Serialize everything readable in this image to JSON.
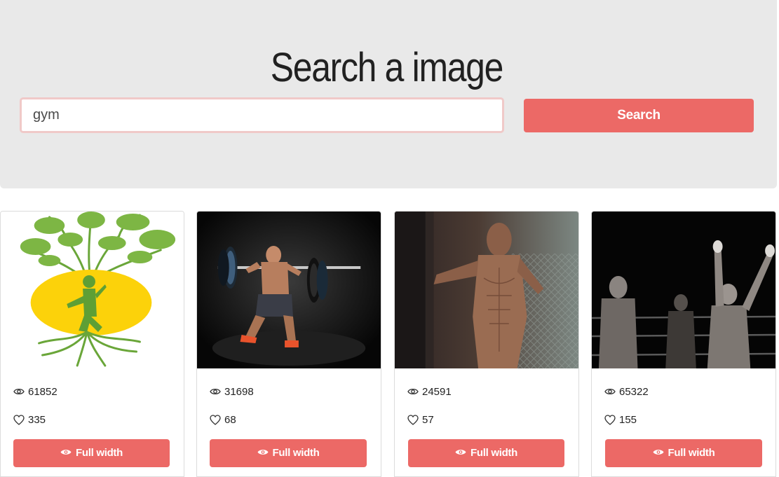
{
  "hero": {
    "title": "Search a image",
    "search_value": "gym",
    "search_button": "Search"
  },
  "colors": {
    "accent": "#ec6966",
    "hero_bg": "#e9e9e9",
    "input_border": "#f0c9c8"
  },
  "results": [
    {
      "views": "61852",
      "likes": "335",
      "button": "Full width",
      "image": "yoga-tree-illustration"
    },
    {
      "views": "31698",
      "likes": "68",
      "button": "Full width",
      "image": "weightlifter-squat-photo"
    },
    {
      "views": "24591",
      "likes": "57",
      "button": "Full width",
      "image": "shirtless-fighter-cage-photo"
    },
    {
      "views": "65322",
      "likes": "155",
      "button": "Full width",
      "image": "boxing-ring-winners-photo"
    }
  ],
  "icons": {
    "views": "eye-icon",
    "likes": "heart-icon",
    "full_width": "eye-icon"
  }
}
